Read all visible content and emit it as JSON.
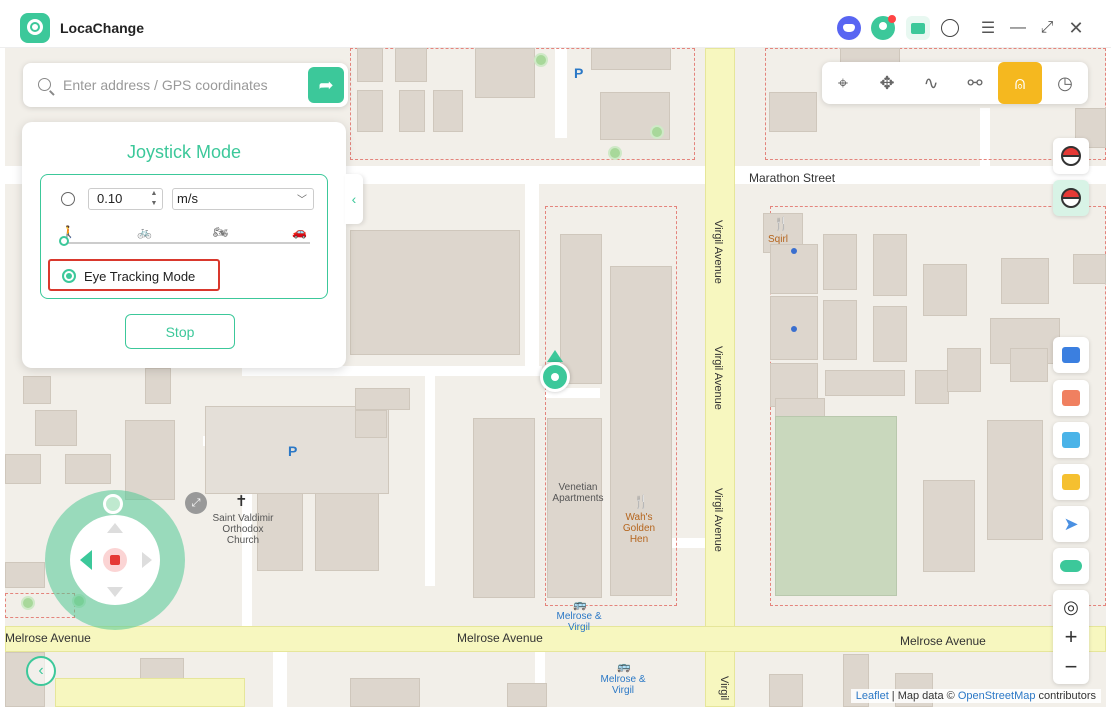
{
  "app": {
    "title": "LocaChange"
  },
  "titlebar_icons": [
    "discord-icon",
    "user-icon",
    "shop-icon",
    "chat-icon",
    "menu-icon",
    "minimize-icon",
    "maximize-icon",
    "close-icon"
  ],
  "search": {
    "placeholder": "Enter address / GPS coordinates",
    "value": ""
  },
  "mode_toolbar": [
    "teleport-mode-icon",
    "multi-spot-move-icon",
    "two-spot-route-icon",
    "multi-stop-route-icon",
    "joystick-mode-icon",
    "history-icon"
  ],
  "panel": {
    "title": "Joystick Mode",
    "speed_value": "0.10",
    "speed_unit": "m/s",
    "eye_tracking_label": "Eye Tracking Mode",
    "stop_label": "Stop"
  },
  "map": {
    "streets": {
      "marathon": "Marathon Street",
      "virgil_1": "Virgil Avenue",
      "virgil_2": "Virgil Avenue",
      "virgil_3": "Virgil Avenue",
      "virgil_4": "Virgil",
      "melrose_left": "Melrose Avenue",
      "melrose_mid": "Melrose Avenue",
      "melrose_right": "Melrose Avenue"
    },
    "places": {
      "sqirl": "Sqirl",
      "venetian": "Venetian Apartments",
      "wahs": "Wah's Golden Hen",
      "church": "Saint Valdimir Orthodox Church",
      "bus1": "Melrose & Virgil",
      "bus2": "Melrose & Virgil"
    },
    "parking": "P"
  },
  "attribution": {
    "leaflet": "Leaflet",
    "sep": " | Map data © ",
    "osm": "OpenStreetMap",
    "suffix": " contributors"
  },
  "colors": {
    "accent": "#3cc89a",
    "active_mode": "#f5b81f",
    "highlight": "#d9382d"
  }
}
